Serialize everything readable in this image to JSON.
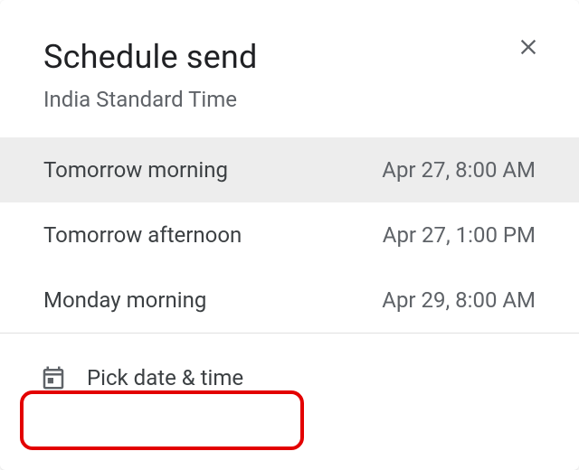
{
  "header": {
    "title": "Schedule send",
    "subtitle": "India Standard Time"
  },
  "options": [
    {
      "label": "Tomorrow morning",
      "time": "Apr 27, 8:00 AM",
      "highlighted": true
    },
    {
      "label": "Tomorrow afternoon",
      "time": "Apr 27, 1:00 PM",
      "highlighted": false
    },
    {
      "label": "Monday morning",
      "time": "Apr 29, 8:00 AM",
      "highlighted": false
    }
  ],
  "footer": {
    "pick_label": "Pick date & time"
  },
  "icons": {
    "close": "close-icon",
    "calendar": "calendar-icon"
  },
  "annotation": {
    "highlight_color": "#e30000"
  }
}
